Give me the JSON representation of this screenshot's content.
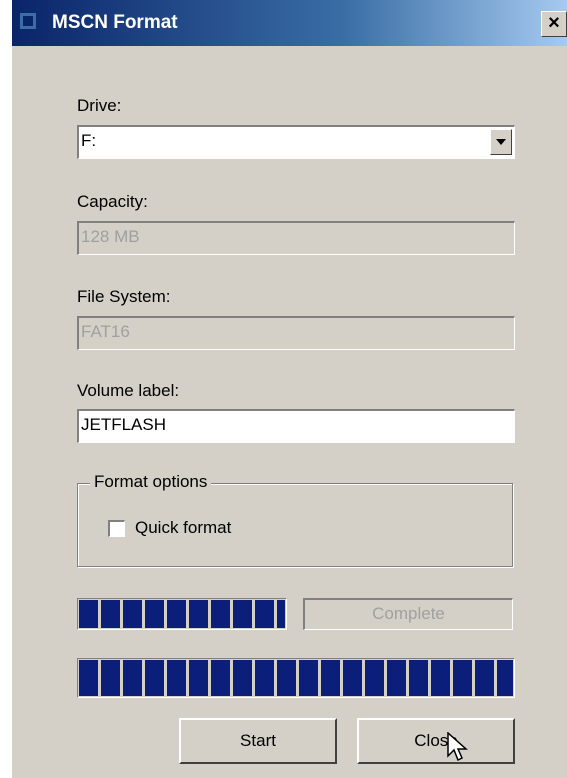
{
  "window": {
    "title": "MSCN Format",
    "close_glyph": "×"
  },
  "drive": {
    "label": "Drive:",
    "value": "F:"
  },
  "capacity": {
    "label": "Capacity:",
    "value": "128 MB"
  },
  "file_system": {
    "label": "File System:",
    "value": "FAT16"
  },
  "volume_label": {
    "label": "Volume label:",
    "value": "JETFLASH"
  },
  "format_options": {
    "legend": "Format options",
    "quick_format_label": "Quick format",
    "quick_format_checked": false
  },
  "status": {
    "text": "Complete",
    "small_progress_fraction": 1.0,
    "main_progress_fraction": 1.0
  },
  "buttons": {
    "start": "Start",
    "close": "Close"
  },
  "colors": {
    "progress": "#0a1e7a",
    "title_bar_start": "#0a246a",
    "dialog_face": "#d4d0c8"
  },
  "icons": [
    "app-icon",
    "close-icon",
    "chevron-down-icon",
    "mouse-cursor-icon"
  ]
}
